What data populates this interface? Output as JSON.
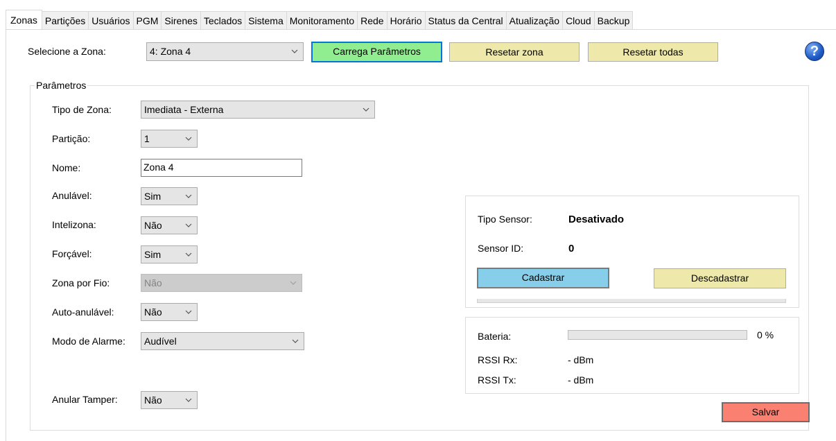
{
  "tabs": [
    "Zonas",
    "Partições",
    "Usuários",
    "PGM",
    "Sirenes",
    "Teclados",
    "Sistema",
    "Monitoramento",
    "Rede",
    "Horário",
    "Status da Central",
    "Atualização",
    "Cloud",
    "Backup"
  ],
  "active_tab": "Zonas",
  "top": {
    "select_zone_label": "Selecione a Zona:",
    "select_zone_value": "4: Zona 4",
    "load_button": "Carrega Parâmetros",
    "reset_zone_button": "Resetar zona",
    "reset_all_button": "Resetar todas",
    "help_glyph": "?"
  },
  "params": {
    "legend": "Parâmetros",
    "tipo_zona_label": "Tipo de Zona:",
    "tipo_zona_value": "Imediata - Externa",
    "particao_label": "Partição:",
    "particao_value": "1",
    "nome_label": "Nome:",
    "nome_value": "Zona 4",
    "anulavel_label": "Anulável:",
    "anulavel_value": "Sim",
    "intelizona_label": "Intelizona:",
    "intelizona_value": "Não",
    "forcavel_label": "Forçável:",
    "forcavel_value": "Sim",
    "zona_fio_label": "Zona por Fio:",
    "zona_fio_value": "Não",
    "auto_anulavel_label": "Auto-anulável:",
    "auto_anulavel_value": "Não",
    "modo_alarme_label": "Modo de Alarme:",
    "modo_alarme_value": "Audível",
    "anular_tamper_label": "Anular Tamper:",
    "anular_tamper_value": "Não"
  },
  "sensor": {
    "tipo_label": "Tipo Sensor:",
    "tipo_value": "Desativado",
    "id_label": "Sensor ID:",
    "id_value": "0",
    "register_button": "Cadastrar",
    "unregister_button": "Descadastrar"
  },
  "status": {
    "battery_label": "Bateria:",
    "battery_percent": 0,
    "battery_text": "0 %",
    "rssi_rx_label": "RSSI Rx:",
    "rssi_rx_value": "- dBm",
    "rssi_tx_label": "RSSI Tx:",
    "rssi_tx_value": "- dBm"
  },
  "save_button": "Salvar",
  "colors": {
    "load_button": "#90ee90",
    "reset_buttons": "#eee8aa",
    "register_button": "#87ceeb",
    "save_button": "#fa8072"
  }
}
